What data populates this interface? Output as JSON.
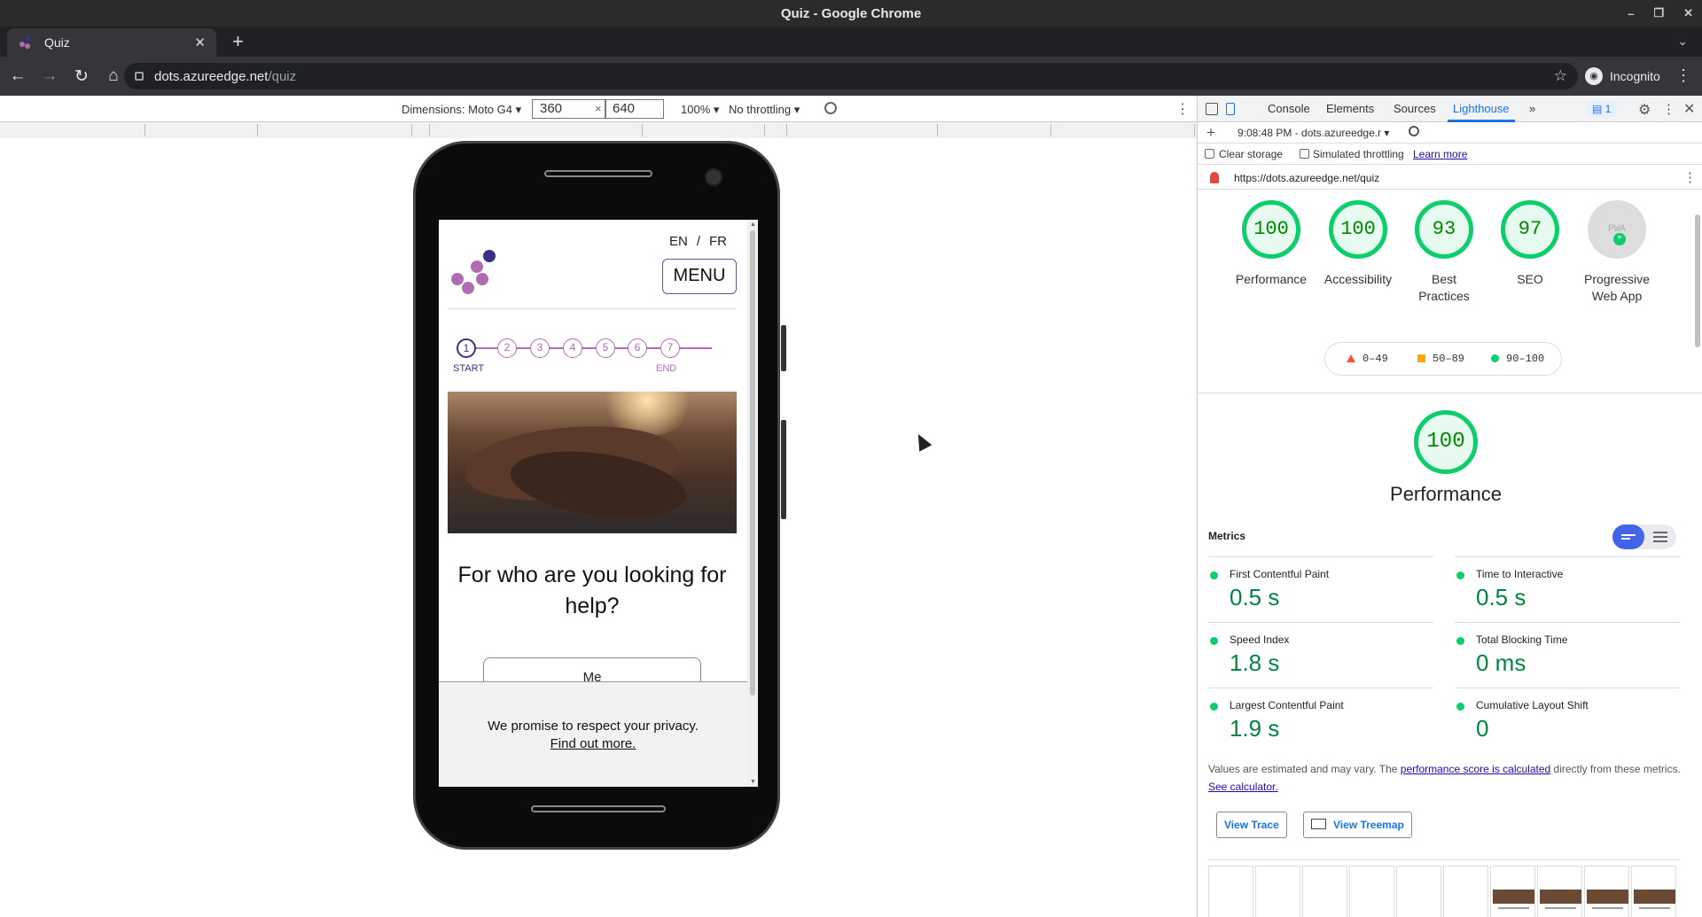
{
  "window": {
    "title": "Quiz - Google Chrome"
  },
  "tab": {
    "title": "Quiz"
  },
  "address": {
    "host": "dots.azureedge.net",
    "path": "/quiz"
  },
  "profile": {
    "label": "Incognito"
  },
  "device_toolbar": {
    "dimensions_label": "Dimensions: Moto G4",
    "width": "360",
    "height": "640",
    "times": "×",
    "zoom": "100%",
    "throttle": "No throttling"
  },
  "page": {
    "lang_en": "EN",
    "lang_sep": "/",
    "lang_fr": "FR",
    "menu": "MENU",
    "steps": [
      "1",
      "2",
      "3",
      "4",
      "5",
      "6",
      "7"
    ],
    "step_start": "START",
    "step_end": "END",
    "question": "For who are you looking for help?",
    "answer_first": "Me",
    "privacy_text": "We promise to respect your privacy.",
    "privacy_link": "Find out more.",
    "colors": {
      "brand_purple": "#3d2e86",
      "accent_pink": "#b46bb6"
    }
  },
  "devtools": {
    "tabs": [
      "Console",
      "Elements",
      "Sources",
      "Lighthouse"
    ],
    "more_tabs": "»",
    "issues_badge": "1",
    "report_label": "9:08:48 PM - dots.azureedge.r",
    "clear_storage": "Clear storage",
    "simulated_throttling": "Simulated throttling",
    "learn_more": "Learn more",
    "url": "https://dots.azureedge.net/quiz",
    "categories": [
      {
        "score": "100",
        "label": "Performance"
      },
      {
        "score": "100",
        "label": "Accessibility"
      },
      {
        "score": "93",
        "label": "Best Practices"
      },
      {
        "score": "97",
        "label": "SEO"
      },
      {
        "score": "PWA",
        "label": "Progressive Web App"
      }
    ],
    "legend": [
      "0–49",
      "50–89",
      "90–100"
    ],
    "perf_score": "100",
    "perf_title": "Performance",
    "metrics_heading": "Metrics",
    "metrics": [
      {
        "name": "First Contentful Paint",
        "value": "0.5 s"
      },
      {
        "name": "Time to Interactive",
        "value": "0.5 s"
      },
      {
        "name": "Speed Index",
        "value": "1.8 s"
      },
      {
        "name": "Total Blocking Time",
        "value": "0 ms"
      },
      {
        "name": "Largest Contentful Paint",
        "value": "1.9 s"
      },
      {
        "name": "Cumulative Layout Shift",
        "value": "0"
      }
    ],
    "note_pre": "Values are estimated and may vary. The ",
    "note_link1": "performance score is calculated",
    "note_mid": " directly from these metrics. ",
    "note_link2": "See calculator.",
    "view_trace": "View Trace",
    "view_treemap": "View Treemap",
    "score_color": "#0cce6b"
  }
}
